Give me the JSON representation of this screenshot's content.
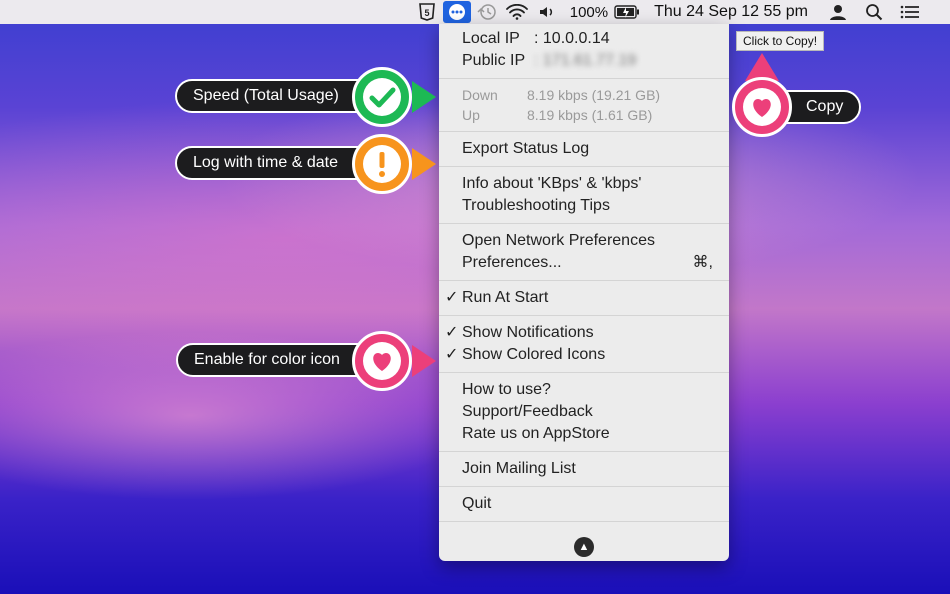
{
  "menubar": {
    "battery": "100%",
    "datetime": "Thu 24 Sep  12 55 pm",
    "icons": [
      "html5-icon",
      "netspeed-icon",
      "time-machine-icon",
      "wifi-icon",
      "volume-icon",
      "battery-icon",
      "user-icon",
      "search-icon",
      "control-center-icon"
    ]
  },
  "menu": {
    "local_ip_label": "Local IP",
    "local_ip_value": ": 10.0.0.14",
    "public_ip_label": "Public IP",
    "public_ip_value": ": 171.61.77.19",
    "down_label": "Down",
    "down_value": "8.19 kbps (19.21 GB)",
    "up_label": "Up",
    "up_value": "8.19 kbps (1.61 GB)",
    "export_log": "Export Status Log",
    "info_kbps": "Info about 'KBps' & 'kbps'",
    "troubleshooting": "Troubleshooting Tips",
    "open_network_prefs": "Open Network Preferences",
    "preferences": "Preferences...",
    "preferences_shortcut": "⌘,",
    "run_at_start": "Run At Start",
    "show_notifications": "Show Notifications",
    "show_colored_icons": "Show Colored Icons",
    "how_to_use": "How to use?",
    "support": "Support/Feedback",
    "rate_us": "Rate us on AppStore",
    "join_mailing": "Join Mailing List",
    "quit": "Quit"
  },
  "callouts": {
    "speed": "Speed (Total Usage)",
    "log": "Log with time & date",
    "color_icon": "Enable for color icon",
    "copy": "Copy",
    "tooltip": "Click to Copy!"
  },
  "colors": {
    "green": "#1db954",
    "orange": "#f7941d",
    "pink": "#ec3f7a",
    "menu_bg": "#ececec",
    "active": "#1f63e0"
  }
}
